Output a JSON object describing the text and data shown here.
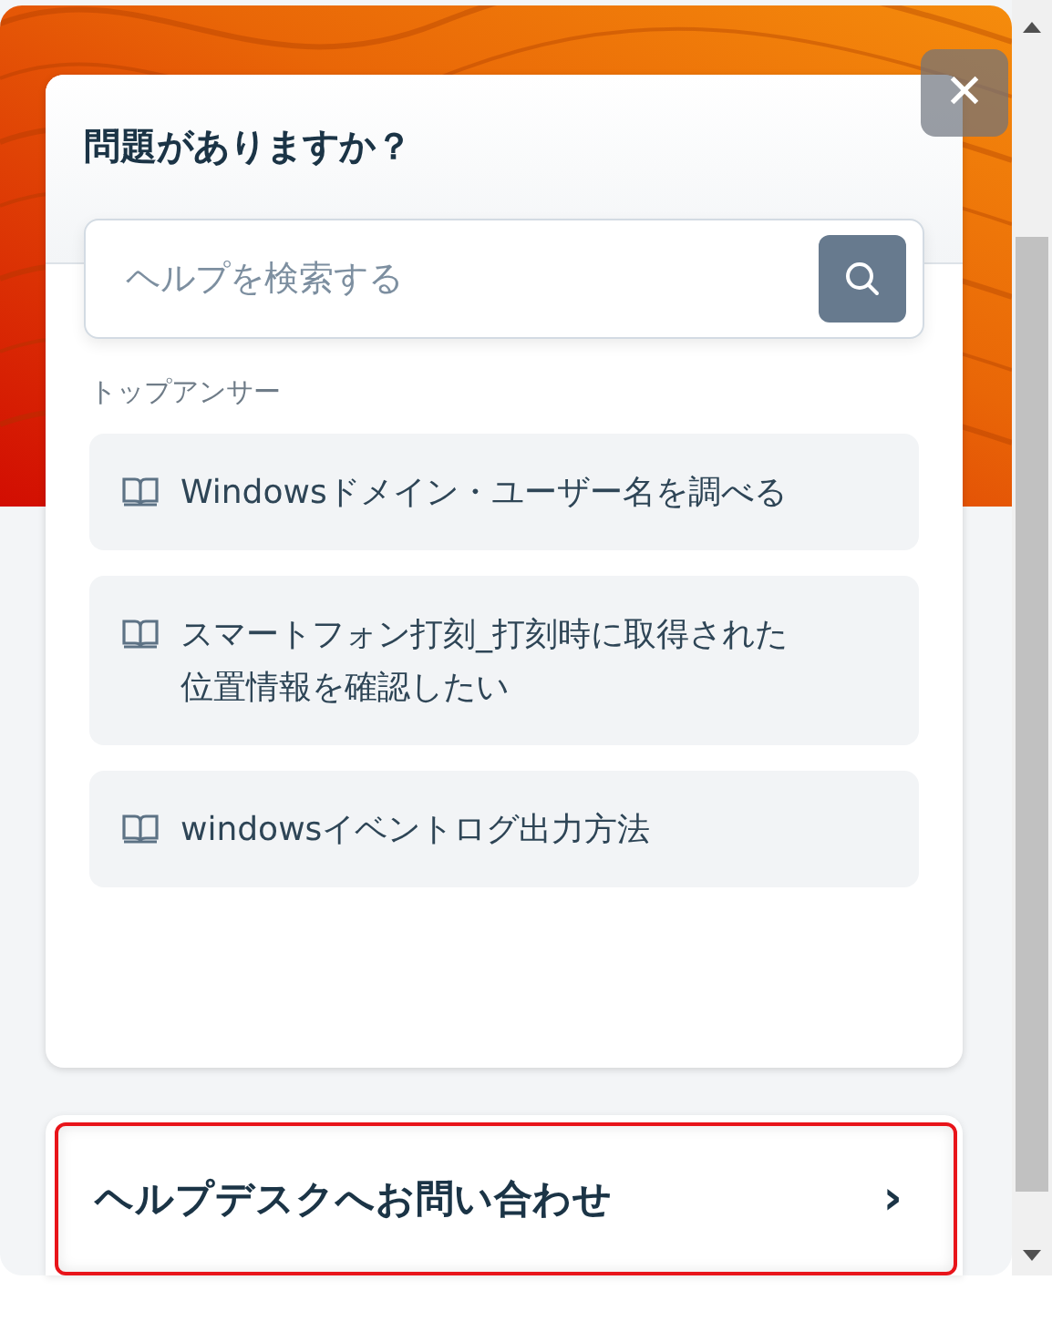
{
  "widget": {
    "title": "問題がありますか？",
    "search": {
      "placeholder": "ヘルプを検索する"
    },
    "section_label": "トップアンサー",
    "answers": [
      {
        "title": "Windowsドメイン・ユーザー名を調べる"
      },
      {
        "title": "スマートフォン打刻_打刻時に取得された位置情報を確認したい"
      },
      {
        "title": "windowsイベントログ出力方法"
      }
    ],
    "contact_button": {
      "label": "ヘルプデスクへお問い合わせ",
      "focused": true,
      "chevron": "›"
    },
    "close_button": {
      "symbol": "✕"
    }
  }
}
